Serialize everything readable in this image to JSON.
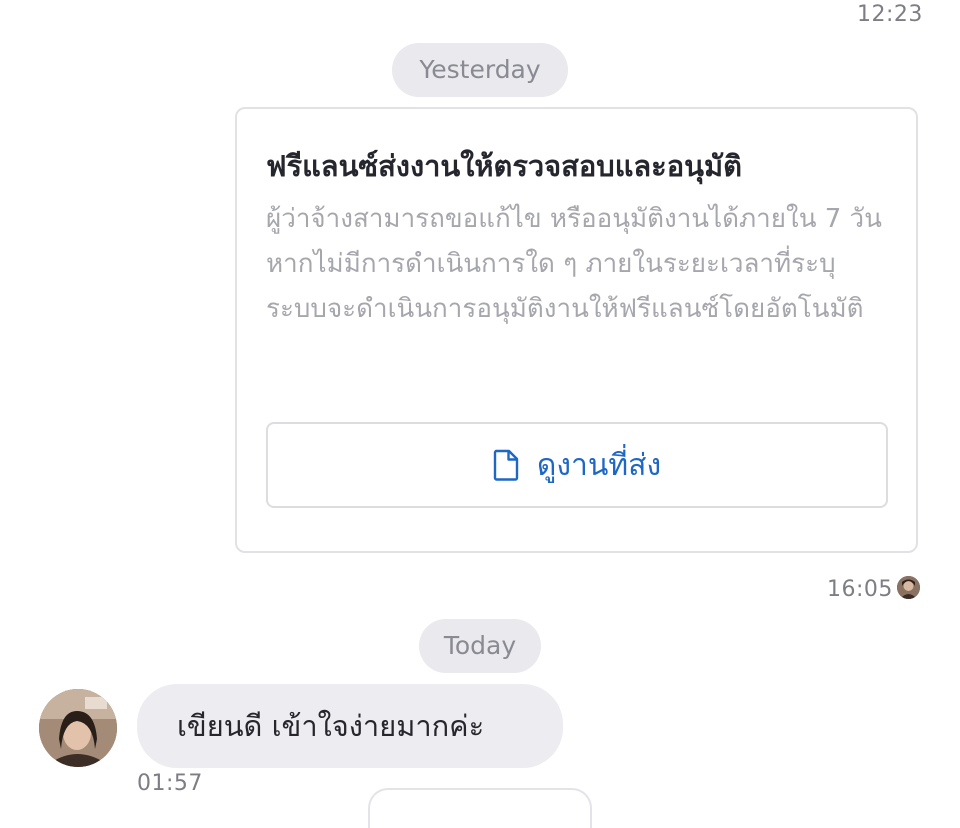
{
  "chat": {
    "top_time": "12:23",
    "date_yesterday": "Yesterday",
    "card": {
      "title": "ฟรีแลนซ์ส่งงานให้ตรวจสอบและอนุมัติ",
      "body": "ผู้ว่าจ้างสามารถขอแก้ไข หรืออนุมัติงานได้ภายใน 7 วัน หากไม่มีการดำเนินการใด ๆ ภายในระยะเวลาที่ระบุ ระบบจะดำเนินการอนุมัติงานให้ฟรีแลนซ์โดยอัตโนมัติ",
      "button_label": "ดูงานที่ส่ง",
      "button_icon": "document-icon",
      "accent_color": "#1f67c4"
    },
    "card_time": "16:05",
    "date_today": "Today",
    "incoming_message": "เขียนดี เข้าใจง่ายมากค่ะ",
    "incoming_time": "01:57"
  }
}
